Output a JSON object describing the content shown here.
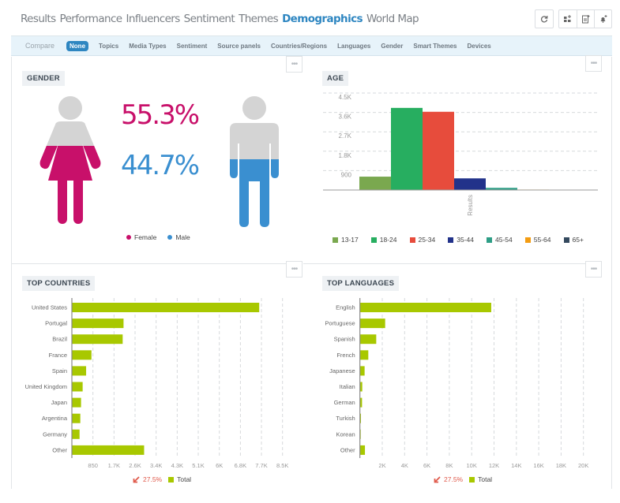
{
  "nav": {
    "tabs": [
      {
        "label": "Results",
        "active": false
      },
      {
        "label": "Performance",
        "active": false
      },
      {
        "label": "Influencers",
        "active": false
      },
      {
        "label": "Sentiment",
        "active": false
      },
      {
        "label": "Themes",
        "active": false
      },
      {
        "label": "Demographics",
        "active": true
      },
      {
        "label": "World Map",
        "active": false
      }
    ],
    "tools": [
      {
        "icon": "refresh-icon",
        "glyph": "↻"
      },
      {
        "icon": "add-widget-icon",
        "glyph": "▪⁺"
      },
      {
        "icon": "add-report-icon",
        "glyph": "🗎"
      },
      {
        "icon": "add-alert-icon",
        "glyph": "🔔"
      }
    ]
  },
  "compare": {
    "label": "Compare",
    "options": [
      {
        "label": "None",
        "selected": true
      },
      {
        "label": "Topics",
        "selected": false
      },
      {
        "label": "Media Types",
        "selected": false
      },
      {
        "label": "Sentiment",
        "selected": false
      },
      {
        "label": "Source panels",
        "selected": false
      },
      {
        "label": "Countries/Regions",
        "selected": false
      },
      {
        "label": "Languages",
        "selected": false
      },
      {
        "label": "Gender",
        "selected": false
      },
      {
        "label": "Smart Themes",
        "selected": false
      },
      {
        "label": "Devices",
        "selected": false
      }
    ]
  },
  "more_glyph": "•••",
  "gender": {
    "title": "GENDER",
    "female": {
      "label": "Female",
      "percent_text": "55.3%",
      "percent": 55.3,
      "color": "#c8106a"
    },
    "male": {
      "label": "Male",
      "percent_text": "44.7%",
      "percent": 44.7,
      "color": "#3a8fd0"
    },
    "figure_gray": "#d4d4d4"
  },
  "chart_data": [
    {
      "id": "age",
      "type": "bar",
      "title": "AGE",
      "xlabel": "Results",
      "ylabel": "",
      "ylim": [
        0,
        4500
      ],
      "yticks": [
        900,
        1800,
        2700,
        3600,
        4500
      ],
      "ytick_labels": [
        "900",
        "1.8K",
        "2.7K",
        "3.6K",
        "4.5K"
      ],
      "grid": true,
      "legend": "bottom",
      "categories": [
        "Results"
      ],
      "series": [
        {
          "name": "13-17",
          "values": [
            620
          ],
          "color": "#7aa84f"
        },
        {
          "name": "18-24",
          "values": [
            3810
          ],
          "color": "#27ae60"
        },
        {
          "name": "25-34",
          "values": [
            3630
          ],
          "color": "#e74c3c"
        },
        {
          "name": "35-44",
          "values": [
            540
          ],
          "color": "#22328a"
        },
        {
          "name": "45-54",
          "values": [
            100
          ],
          "color": "#2e9e86"
        },
        {
          "name": "55-64",
          "values": [
            20
          ],
          "color": "#f39c12"
        },
        {
          "name": "65+",
          "values": [
            15
          ],
          "color": "#34495e"
        }
      ]
    },
    {
      "id": "countries",
      "type": "bar",
      "orientation": "horizontal",
      "title": "TOP COUNTRIES",
      "xlim": [
        0,
        8500
      ],
      "xticks": [
        850,
        1700,
        2550,
        3400,
        4250,
        5100,
        5950,
        6800,
        7650,
        8500
      ],
      "xtick_labels": [
        "850",
        "1.7K",
        "2.6K",
        "3.4K",
        "4.3K",
        "5.1K",
        "6K",
        "6.8K",
        "7.7K",
        "8.5K"
      ],
      "grid": true,
      "legend": "bottom",
      "categories": [
        "United States",
        "Portugal",
        "Brazil",
        "France",
        "Spain",
        "United Kingdom",
        "Japan",
        "Argentina",
        "Germany",
        "Other"
      ],
      "series": [
        {
          "name": "Total",
          "values": [
            7560,
            2085,
            2050,
            790,
            575,
            435,
            370,
            340,
            310,
            2915
          ],
          "color": "#a8c800"
        }
      ],
      "change_text": "27.5%",
      "change_direction": "down"
    },
    {
      "id": "languages",
      "type": "bar",
      "orientation": "horizontal",
      "title": "TOP LANGUAGES",
      "xlim": [
        0,
        21000
      ],
      "xticks": [
        2000,
        4000,
        6000,
        8000,
        10000,
        12000,
        14000,
        16000,
        18000,
        20000
      ],
      "xtick_labels": [
        "2K",
        "4K",
        "6K",
        "8K",
        "10K",
        "12K",
        "14K",
        "16K",
        "18K",
        "20K"
      ],
      "grid": true,
      "legend": "bottom",
      "categories": [
        "English",
        "Portuguese",
        "Spanish",
        "French",
        "Japanese",
        "Italian",
        "German",
        "Turkish",
        "Korean",
        "Other"
      ],
      "series": [
        {
          "name": "Total",
          "values": [
            11750,
            2260,
            1460,
            750,
            420,
            210,
            190,
            90,
            70,
            450
          ],
          "color": "#a8c800"
        }
      ],
      "change_text": "27.5%",
      "change_direction": "down"
    }
  ]
}
